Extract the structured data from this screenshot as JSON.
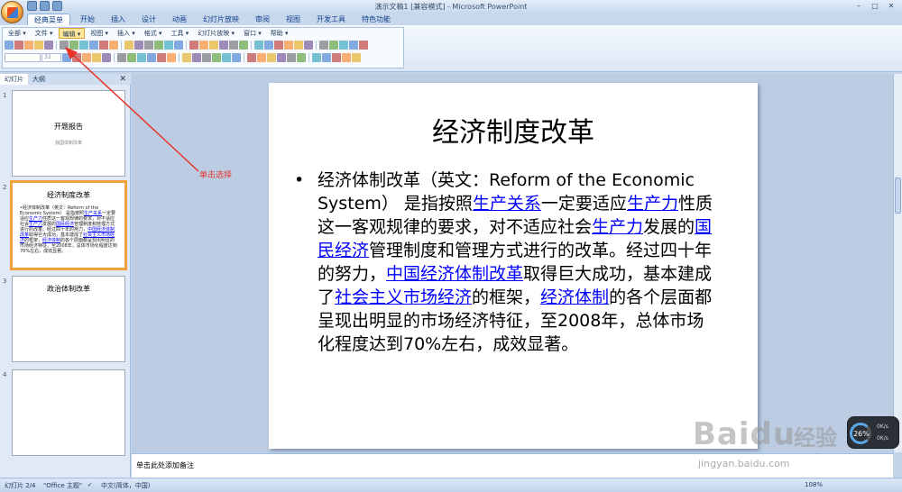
{
  "window": {
    "title": "演示文稿1 [兼容模式] - Microsoft PowerPoint",
    "minimize": "–",
    "maximize": "□",
    "close": "✕"
  },
  "ribbon_tabs": [
    {
      "label": "经典菜单",
      "active": true
    },
    {
      "label": "开始",
      "active": false
    },
    {
      "label": "插入",
      "active": false
    },
    {
      "label": "设计",
      "active": false
    },
    {
      "label": "动画",
      "active": false
    },
    {
      "label": "幻灯片放映",
      "active": false
    },
    {
      "label": "审阅",
      "active": false
    },
    {
      "label": "视图",
      "active": false
    },
    {
      "label": "开发工具",
      "active": false
    },
    {
      "label": "特色功能",
      "active": false
    }
  ],
  "classic_menu": [
    {
      "label": "全部 ▾",
      "highlight": false
    },
    {
      "label": "文件 ▾",
      "highlight": false
    },
    {
      "label": "编辑 ▾",
      "highlight": true
    },
    {
      "label": "视图 ▾",
      "highlight": false
    },
    {
      "label": "插入 ▾",
      "highlight": false
    },
    {
      "label": "格式 ▾",
      "highlight": false
    },
    {
      "label": "工具 ▾",
      "highlight": false
    },
    {
      "label": "幻灯片放映 ▾",
      "highlight": false
    },
    {
      "label": "窗口 ▾",
      "highlight": false
    },
    {
      "label": "帮助 ▾",
      "highlight": false
    }
  ],
  "font_size_combo": "32",
  "left_pane": {
    "tabs": [
      "幻灯片",
      "大纲"
    ],
    "close": "✕",
    "slides": [
      {
        "num": "1",
        "title": "开题报告",
        "subtitle": "我国体制改革"
      },
      {
        "num": "2",
        "title": "经济制度改革",
        "selected": true
      },
      {
        "num": "3",
        "title": "政治体制改革"
      },
      {
        "num": "4",
        "title": ""
      }
    ]
  },
  "slide": {
    "title": "经济制度改革",
    "bullet": "•",
    "body_segments": [
      {
        "text": "经济体制改革（英文：Reform of the Economic System） 是指按照",
        "link": false
      },
      {
        "text": "生产关系",
        "link": true
      },
      {
        "text": "一定要适应",
        "link": false
      },
      {
        "text": "生产力",
        "link": true
      },
      {
        "text": "性质这一客观规律的要求，对不适应社会",
        "link": false
      },
      {
        "text": "生产力",
        "link": true
      },
      {
        "text": "发展的",
        "link": false
      },
      {
        "text": "国民经济",
        "link": true
      },
      {
        "text": "管理制度和管理方式进行的改革。经过四十年的努力，",
        "link": false
      },
      {
        "text": "中国经济体制改革",
        "link": true
      },
      {
        "text": "取得巨大成功，基本建成了",
        "link": false
      },
      {
        "text": "社会主义市场经济",
        "link": true
      },
      {
        "text": "的框架，",
        "link": false
      },
      {
        "text": "经济体制",
        "link": true
      },
      {
        "text": "的各个层面都呈现出明显的市场经济特征，至2008年，总体市场化程度达到70%左右，成效显著。",
        "link": false
      }
    ]
  },
  "notes": {
    "placeholder": "单击此处添加备注"
  },
  "annotation": {
    "label": "单击选择",
    "color": "#e8332a"
  },
  "status_bar": {
    "slide_pos": "幻灯片 2/4",
    "theme": "\"Office 主题\"",
    "language": "中文(简体，中国)",
    "zoom": "108%"
  },
  "watermark": {
    "logo": "Baidu",
    "cn": "经验",
    "url": "jingyan.baidu.com"
  },
  "widget": {
    "value": "26",
    "unit": "%",
    "line1": "0K/s",
    "line2": "0K/s"
  }
}
